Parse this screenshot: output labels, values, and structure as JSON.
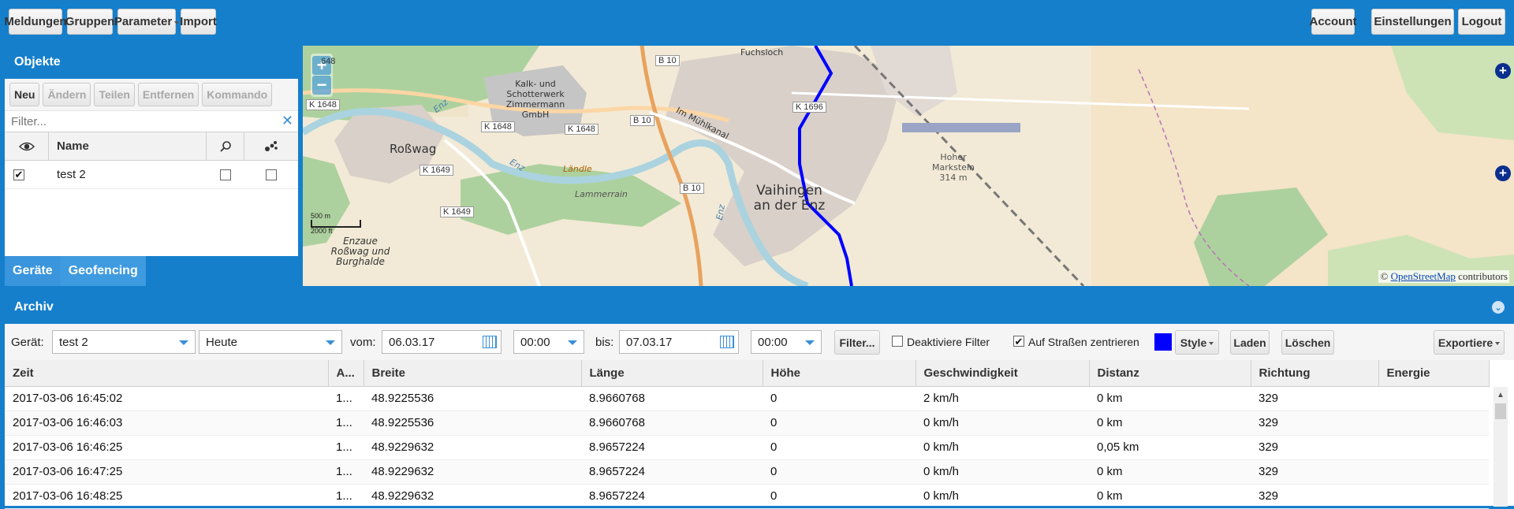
{
  "toolbar": {
    "left": [
      "Meldungen",
      "Gruppen",
      "Parameter",
      "Import"
    ],
    "right": [
      "Account",
      "Einstellungen",
      "Logout"
    ]
  },
  "objects": {
    "title": "Objekte",
    "buttons": [
      "Neu",
      "Ändern",
      "Teilen",
      "Entfernen",
      "Kommando"
    ],
    "filter_placeholder": "Filter...",
    "columns": {
      "name": "Name"
    },
    "rows": [
      {
        "visible": true,
        "name": "test 2",
        "follow": false,
        "trail": false
      }
    ],
    "tabs": [
      "Geräte",
      "Geofencing"
    ]
  },
  "map": {
    "labels": {
      "rosswag": "Roßwag",
      "vaihingen": "Vaihingen an der Enz",
      "kalk": "Kalk- und Schotterwerk Zimmermann GmbH",
      "hoher": "Hoher Markstein 314 m",
      "fuchsloch": "Fuchsloch",
      "landle": "Ländle",
      "lammerrain": "Lammerrain",
      "muhlkanal": "Im Mühlkanal",
      "enzaue": "Enzaue Roßwag und Burghalde",
      "enz1": "Enz",
      "enz2": "Enz",
      "enz3": "Enz"
    },
    "roads": [
      "K 1648",
      "K 1648",
      "K 1648",
      "K 1649",
      "K 1649",
      "B 10",
      "B 10",
      "B 10",
      "K 1696",
      "648"
    ],
    "scale": {
      "meters": "500 m",
      "feet": "2000 ft"
    },
    "attribution_prefix": "©",
    "attribution_link": "OpenStreetMap",
    "attribution_suffix": "contributors",
    "track_color": "#0000ff"
  },
  "archive": {
    "title": "Archiv",
    "device_label": "Gerät:",
    "device_value": "test 2",
    "period_value": "Heute",
    "from_label": "vom:",
    "from_date": "06.03.17",
    "from_time": "00:00",
    "to_label": "bis:",
    "to_date": "07.03.17",
    "to_time": "00:00",
    "filter_button": "Filter...",
    "disable_filter_label": "Deaktiviere Filter",
    "disable_filter_checked": false,
    "snap_label": "Auf Straßen zentrieren",
    "snap_checked": true,
    "track_color": "#0000ff",
    "style_button": "Style",
    "load_button": "Laden",
    "clear_button": "Löschen",
    "export_button": "Exportiere",
    "columns": [
      "Zeit",
      "A...",
      "Breite",
      "Länge",
      "Höhe",
      "Geschwindigkeit",
      "Distanz",
      "Richtung",
      "Energie"
    ],
    "rows": [
      [
        "2017-03-06 16:45:02",
        "1...",
        "48.9225536",
        "8.9660768",
        "0",
        "2 km/h",
        "0 km",
        "329",
        ""
      ],
      [
        "2017-03-06 16:46:03",
        "1...",
        "48.9225536",
        "8.9660768",
        "0",
        "0 km/h",
        "0 km",
        "329",
        ""
      ],
      [
        "2017-03-06 16:46:25",
        "1...",
        "48.9229632",
        "8.9657224",
        "0",
        "0 km/h",
        "0,05 km",
        "329",
        ""
      ],
      [
        "2017-03-06 16:47:25",
        "1...",
        "48.9229632",
        "8.9657224",
        "0",
        "0 km/h",
        "0 km",
        "329",
        ""
      ],
      [
        "2017-03-06 16:48:25",
        "1...",
        "48.9229632",
        "8.9657224",
        "0",
        "0 km/h",
        "0 km",
        "329",
        ""
      ]
    ]
  }
}
